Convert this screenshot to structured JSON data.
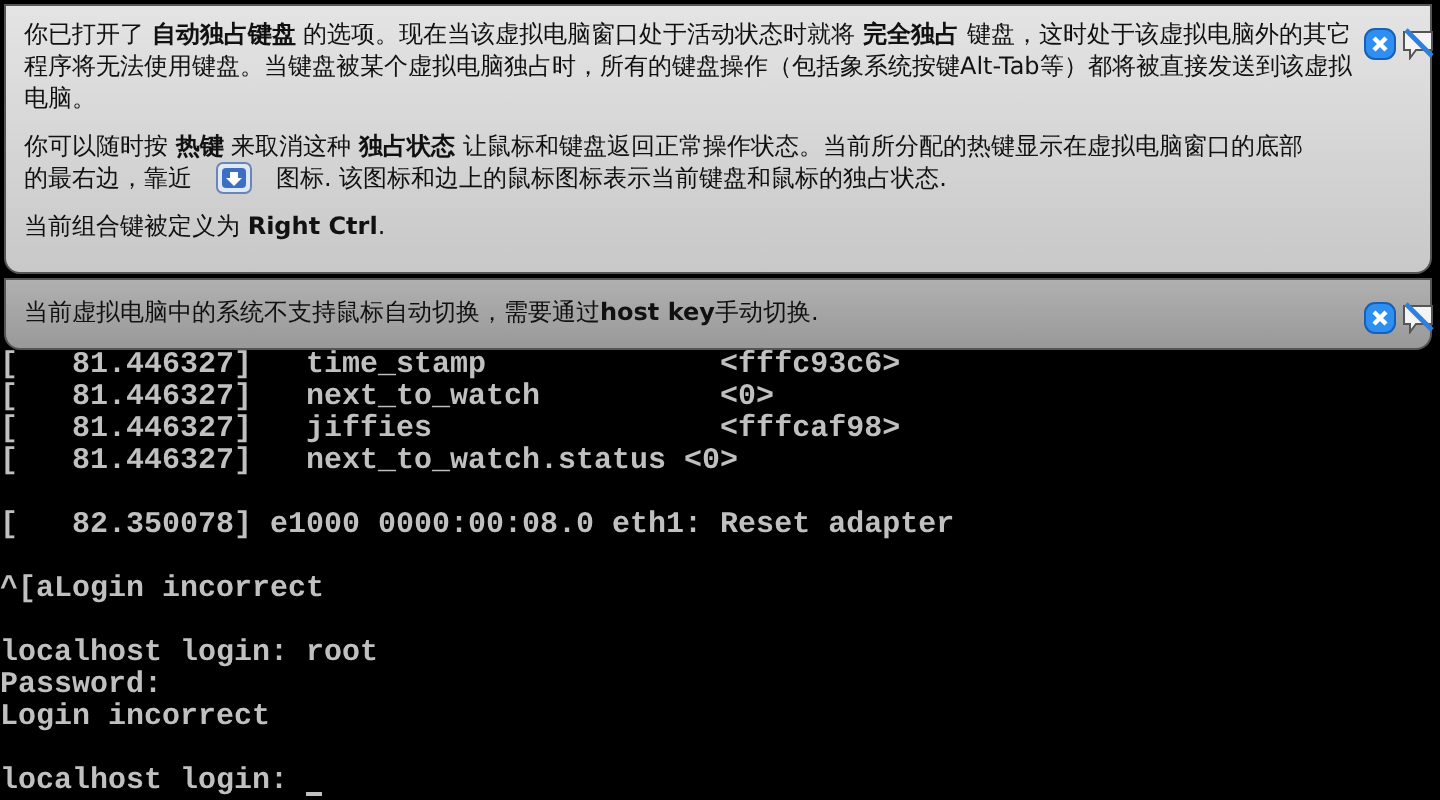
{
  "banners": [
    {
      "kind": "light",
      "paragraphs": [
        {
          "text": "你已打开了 **自动独占键盘** 的选项。现在当该虚拟电脑窗口处于活动状态时就将 **完全独占** 键盘，这时处于该虚拟电脑外的其它程序将无法使用键盘。当键盘被某个虚拟电脑独占时，所有的键盘操作（包括象系统按键Alt-Tab等）都将被直接发送到该虚拟电脑。"
        },
        {
          "text": "你可以随时按 **热键** 来取消这种 **独占状态** 让鼠标和键盘返回正常操作状态。当前所分配的热键显示在虚拟电脑窗口的底部",
          "before_icon": "的最右边，靠近",
          "after_icon": "图标. 该图标和边上的鼠标图标表示当前键盘和鼠标的独占状态."
        },
        {
          "text": "当前组合键被定义为 **Right Ctrl**."
        }
      ]
    },
    {
      "kind": "dark",
      "paragraphs": [
        {
          "text": "当前虚拟电脑中的系统不支持鼠标自动切换，需要通过**host key**手动切换."
        }
      ]
    }
  ],
  "terminal_blocks": [
    [
      "[   81.446327]   time_stamp             <fffc93c6>",
      "[   81.446327]   next_to_watch          <0>",
      "[   81.446327]   jiffies                <fffcaf98>",
      "[   81.446327]   next_to_watch.status <0>"
    ],
    [
      "[   82.350078] e1000 0000:00:08.0 eth1: Reset adapter"
    ],
    [
      "^[aLogin incorrect"
    ],
    [
      "localhost login: root",
      "Password:",
      "Login incorrect"
    ],
    [
      "localhost login: "
    ]
  ]
}
